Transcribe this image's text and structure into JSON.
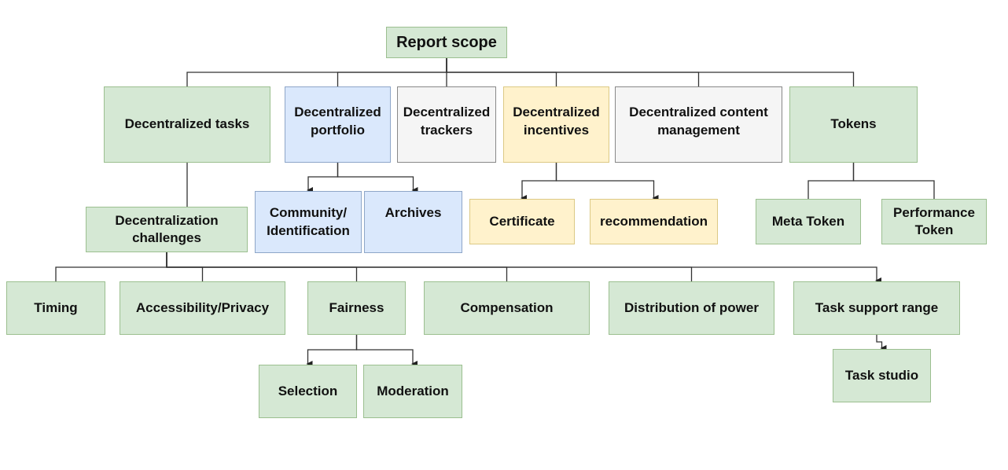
{
  "diagram": {
    "title": "Report scope",
    "colors": {
      "green_fill": "#d5e8d4",
      "blue_fill": "#dae8fc",
      "yellow_fill": "#fff2cc",
      "gray_fill": "#f5f5f5",
      "edge": "#333333"
    },
    "nodes": {
      "report_scope": "Report scope",
      "decentralized_tasks": "Decentralized tasks",
      "decentralized_portfolio": "Decentralized\nportfolio",
      "decentralized_trackers": "Decentralized\ntrackers",
      "decentralized_incentives": "Decentralized\nincentives",
      "decentralized_content_management": "Decentralized content\nmanagement",
      "tokens": "Tokens",
      "decentralization_challenges": "Decentralization\nchallenges",
      "community_identification": "Community/\nIdentification",
      "archives": "Archives",
      "certificate": "Certificate",
      "recommendation": "recommendation",
      "meta_token": "Meta Token",
      "performance_token": "Performance\nToken",
      "timing": "Timing",
      "accessibility_privacy": "Accessibility/Privacy",
      "fairness": "Fairness",
      "compensation": "Compensation",
      "distribution_of_power": "Distribution of power",
      "task_support_range": "Task support range",
      "selection": "Selection",
      "moderation": "Moderation",
      "task_studio": "Task studio"
    },
    "edges": [
      {
        "from": "report_scope",
        "to": "decentralized_tasks",
        "arrow": false
      },
      {
        "from": "report_scope",
        "to": "decentralized_portfolio",
        "arrow": false
      },
      {
        "from": "report_scope",
        "to": "decentralized_trackers",
        "arrow": false
      },
      {
        "from": "report_scope",
        "to": "decentralized_incentives",
        "arrow": false
      },
      {
        "from": "report_scope",
        "to": "decentralized_content_management",
        "arrow": false
      },
      {
        "from": "report_scope",
        "to": "tokens",
        "arrow": false
      },
      {
        "from": "decentralized_tasks",
        "to": "decentralization_challenges",
        "arrow": false
      },
      {
        "from": "decentralized_portfolio",
        "to": "community_identification",
        "arrow": true
      },
      {
        "from": "decentralized_portfolio",
        "to": "archives",
        "arrow": true
      },
      {
        "from": "decentralized_incentives",
        "to": "certificate",
        "arrow": true
      },
      {
        "from": "decentralized_incentives",
        "to": "recommendation",
        "arrow": true
      },
      {
        "from": "tokens",
        "to": "meta_token",
        "arrow": false
      },
      {
        "from": "tokens",
        "to": "performance_token",
        "arrow": false
      },
      {
        "from": "decentralization_challenges",
        "to": "timing",
        "arrow": false
      },
      {
        "from": "decentralization_challenges",
        "to": "accessibility_privacy",
        "arrow": false
      },
      {
        "from": "decentralization_challenges",
        "to": "fairness",
        "arrow": false
      },
      {
        "from": "decentralization_challenges",
        "to": "compensation",
        "arrow": false
      },
      {
        "from": "decentralization_challenges",
        "to": "distribution_of_power",
        "arrow": false
      },
      {
        "from": "decentralization_challenges",
        "to": "task_support_range",
        "arrow": true
      },
      {
        "from": "fairness",
        "to": "selection",
        "arrow": true
      },
      {
        "from": "fairness",
        "to": "moderation",
        "arrow": true
      },
      {
        "from": "task_support_range",
        "to": "task_studio",
        "arrow": true
      }
    ]
  }
}
